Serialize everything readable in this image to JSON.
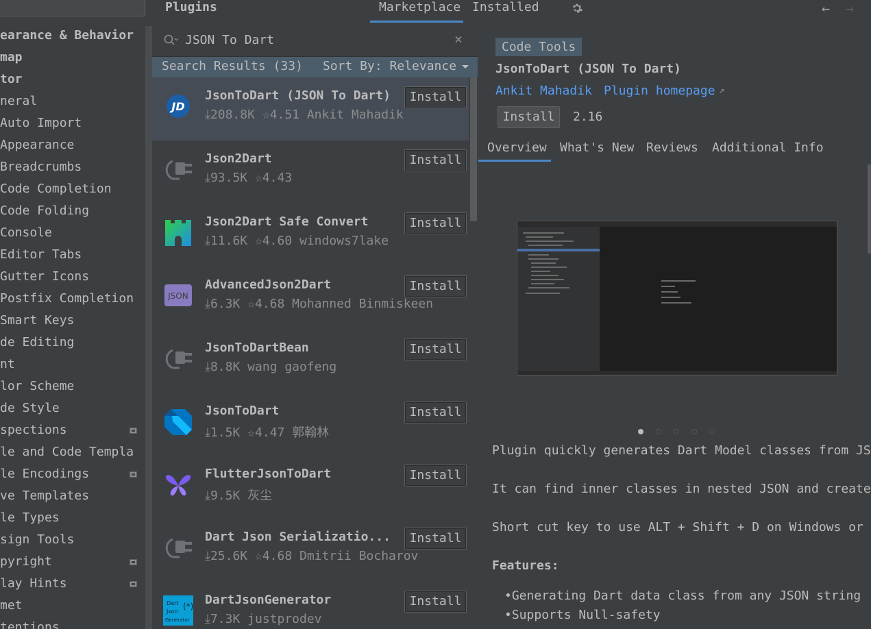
{
  "header": {
    "title": "Plugins",
    "tabs": [
      "Marketplace",
      "Installed"
    ],
    "active_tab": "Marketplace",
    "back_icon": "arrow-left-icon",
    "forward_icon": "arrow-right-icon",
    "settings_icon": "gear-icon"
  },
  "settings_tree": {
    "items": [
      {
        "label": "earance & Behavior",
        "bold": true
      },
      {
        "label": "map",
        "bold": true
      },
      {
        "label": "tor",
        "bold": true
      },
      {
        "label": "neral"
      },
      {
        "label": "Auto Import"
      },
      {
        "label": "Appearance"
      },
      {
        "label": "Breadcrumbs"
      },
      {
        "label": "Code Completion"
      },
      {
        "label": "Code Folding"
      },
      {
        "label": "Console"
      },
      {
        "label": "Editor Tabs"
      },
      {
        "label": "Gutter Icons"
      },
      {
        "label": "Postfix Completion"
      },
      {
        "label": "Smart Keys"
      },
      {
        "label": "de Editing"
      },
      {
        "label": "nt"
      },
      {
        "label": "lor Scheme"
      },
      {
        "label": "de Style"
      },
      {
        "label": "spections",
        "badge": true
      },
      {
        "label": "le and Code Templa"
      },
      {
        "label": "le Encodings",
        "badge": true
      },
      {
        "label": "ve Templates"
      },
      {
        "label": "le Types"
      },
      {
        "label": "sign Tools"
      },
      {
        "label": "pyright",
        "badge": true
      },
      {
        "label": "lay Hints",
        "badge": true
      },
      {
        "label": "met"
      },
      {
        "label": "tentions"
      }
    ]
  },
  "search": {
    "value": "JSON To Dart",
    "results_label": "Search Results (33)",
    "sort_label": "Sort By: Relevance"
  },
  "plugins": [
    {
      "name": "JsonToDart (JSON To Dart)",
      "meta": "⤓208.8K ☆4.51 Ankit Mahadik",
      "icon": "jd-logo-icon",
      "install": "Install",
      "selected": true
    },
    {
      "name": "Json2Dart",
      "meta": "⤓93.5K ☆4.43",
      "icon": "plugin-plug-icon",
      "install": "Install"
    },
    {
      "name": "Json2Dart Safe Convert",
      "meta": "⤓11.6K ☆4.60 windows7lake",
      "icon": "castle-icon",
      "install": "Install"
    },
    {
      "name": "AdvancedJson2Dart",
      "meta": "⤓6.3K ☆4.68 Mohanned Binmiskeen",
      "icon": "json-badge-icon",
      "install": "Install"
    },
    {
      "name": "JsonToDartBean",
      "meta": "⤓8.8K wang gaofeng",
      "icon": "plugin-plug-icon",
      "install": "Install"
    },
    {
      "name": "JsonToDart",
      "meta": "⤓1.5K ☆4.47 郭翰林",
      "icon": "dart-logo-icon",
      "install": "Install"
    },
    {
      "name": "FlutterJsonToDart",
      "meta": "⤓9.5K 灰尘",
      "icon": "butterfly-icon",
      "install": "Install"
    },
    {
      "name": "Dart Json Serializatio...",
      "meta": "⤓25.6K ☆4.68 Dmitrii Bocharov",
      "icon": "plugin-plug-icon",
      "install": "Install"
    },
    {
      "name": "DartJsonGenerator",
      "meta": "⤓7.3K justprodev",
      "icon": "dart-json-generator-icon",
      "install": "Install"
    }
  ],
  "details": {
    "category": "Code Tools",
    "name": "JsonToDart (JSON To Dart)",
    "vendor": "Ankit Mahadik",
    "homepage": "Plugin homepage",
    "homepage_arrow": "↗",
    "install": "Install",
    "version": "2.16",
    "tabs": [
      "Overview",
      "What's New",
      "Reviews",
      "Additional Info"
    ],
    "active_tab": "Overview",
    "screenshot_count": 5,
    "screenshot_active": 1,
    "description": [
      "Plugin quickly generates Dart Model classes from JS",
      "It can find inner classes in nested JSON and create",
      "Short cut key to use ALT + Shift + D on Windows or"
    ],
    "features_heading": "Features:",
    "features": [
      "Generating Dart data class from any JSON string",
      "Supports Null-safety"
    ]
  }
}
